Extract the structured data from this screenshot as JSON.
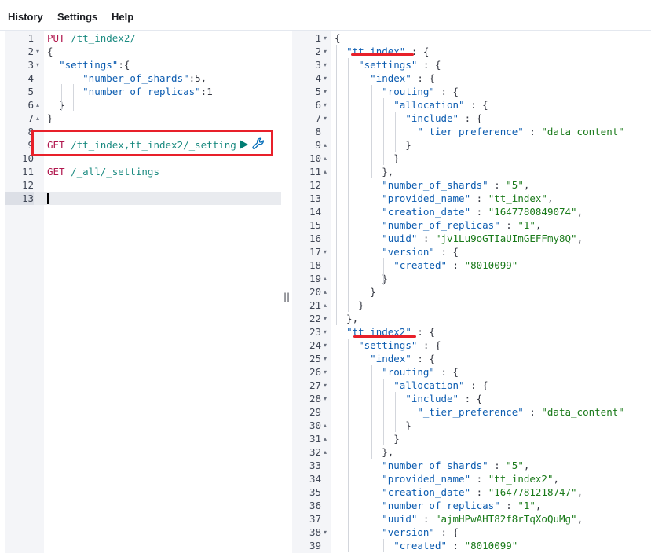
{
  "menu": {
    "history": "History",
    "settings": "Settings",
    "help": "Help"
  },
  "editor_request": {
    "line_numbers": [
      "1",
      "2",
      "3",
      "4",
      "5",
      "6",
      "7",
      "8",
      "9",
      "10",
      "11",
      "12",
      "13"
    ],
    "lines": [
      [
        {
          "t": "PUT",
          "c": "m-put"
        },
        {
          "t": " /tt_index2/",
          "c": "url"
        }
      ],
      [
        {
          "t": "{",
          "c": "pun"
        }
      ],
      [
        {
          "t": "  ",
          "c": "pun"
        },
        {
          "t": "\"settings\"",
          "c": "key"
        },
        {
          "t": ":{",
          "c": "pun"
        }
      ],
      [
        {
          "t": "      ",
          "c": "pun"
        },
        {
          "t": "\"number_of_shards\"",
          "c": "key"
        },
        {
          "t": ":5,",
          "c": "pun"
        }
      ],
      [
        {
          "t": "      ",
          "c": "pun"
        },
        {
          "t": "\"number_of_replicas\"",
          "c": "key"
        },
        {
          "t": ":1",
          "c": "pun"
        }
      ],
      [
        {
          "t": "  }",
          "c": "pun"
        }
      ],
      [
        {
          "t": "}",
          "c": "pun"
        }
      ],
      [],
      [
        {
          "t": "GET",
          "c": "m-get"
        },
        {
          "t": " /tt_index,tt_index2/_setting",
          "c": "url"
        }
      ],
      [],
      [
        {
          "t": "GET",
          "c": "m-get"
        },
        {
          "t": " /_all/_settings",
          "c": "url"
        }
      ],
      [],
      []
    ],
    "fold_markers": [
      "",
      "▾",
      "▾",
      "",
      "",
      "▴",
      "▴",
      "",
      "",
      "",
      "",
      "",
      ""
    ]
  },
  "editor_response": {
    "line_numbers": [
      "1",
      "2",
      "3",
      "4",
      "5",
      "6",
      "7",
      "8",
      "9",
      "10",
      "11",
      "12",
      "13",
      "14",
      "15",
      "16",
      "17",
      "18",
      "19",
      "20",
      "21",
      "22",
      "23",
      "24",
      "25",
      "26",
      "27",
      "28",
      "29",
      "30",
      "31",
      "32",
      "33",
      "34",
      "35",
      "36",
      "37",
      "38",
      "39"
    ],
    "fold_markers": [
      "▾",
      "▾",
      "▾",
      "▾",
      "▾",
      "▾",
      "▾",
      "",
      "▴",
      "▴",
      "▴",
      "",
      "",
      "",
      "",
      "",
      "▾",
      "",
      "▴",
      "▴",
      "▴",
      "▾",
      "▾",
      "▾",
      "▾",
      "▾",
      "▾",
      "▾",
      "",
      "▴",
      "▴",
      "▴",
      "",
      "",
      "",
      "",
      "",
      "▾",
      ""
    ],
    "lines": [
      [
        {
          "t": "{",
          "c": "pun"
        }
      ],
      [
        {
          "t": "  ",
          "c": "pun"
        },
        {
          "t": "\"tt_index\"",
          "c": "key"
        },
        {
          "t": " : {",
          "c": "pun"
        }
      ],
      [
        {
          "t": "    ",
          "c": "pun"
        },
        {
          "t": "\"settings\"",
          "c": "key"
        },
        {
          "t": " : {",
          "c": "pun"
        }
      ],
      [
        {
          "t": "      ",
          "c": "pun"
        },
        {
          "t": "\"index\"",
          "c": "key"
        },
        {
          "t": " : {",
          "c": "pun"
        }
      ],
      [
        {
          "t": "        ",
          "c": "pun"
        },
        {
          "t": "\"routing\"",
          "c": "key"
        },
        {
          "t": " : {",
          "c": "pun"
        }
      ],
      [
        {
          "t": "          ",
          "c": "pun"
        },
        {
          "t": "\"allocation\"",
          "c": "key"
        },
        {
          "t": " : {",
          "c": "pun"
        }
      ],
      [
        {
          "t": "            ",
          "c": "pun"
        },
        {
          "t": "\"include\"",
          "c": "key"
        },
        {
          "t": " : {",
          "c": "pun"
        }
      ],
      [
        {
          "t": "              ",
          "c": "pun"
        },
        {
          "t": "\"_tier_preference\"",
          "c": "key"
        },
        {
          "t": " : ",
          "c": "pun"
        },
        {
          "t": "\"data_content\"",
          "c": "str"
        }
      ],
      [
        {
          "t": "            }",
          "c": "pun"
        }
      ],
      [
        {
          "t": "          }",
          "c": "pun"
        }
      ],
      [
        {
          "t": "        },",
          "c": "pun"
        }
      ],
      [
        {
          "t": "        ",
          "c": "pun"
        },
        {
          "t": "\"number_of_shards\"",
          "c": "key"
        },
        {
          "t": " : ",
          "c": "pun"
        },
        {
          "t": "\"5\"",
          "c": "str"
        },
        {
          "t": ",",
          "c": "pun"
        }
      ],
      [
        {
          "t": "        ",
          "c": "pun"
        },
        {
          "t": "\"provided_name\"",
          "c": "key"
        },
        {
          "t": " : ",
          "c": "pun"
        },
        {
          "t": "\"tt_index\"",
          "c": "str"
        },
        {
          "t": ",",
          "c": "pun"
        }
      ],
      [
        {
          "t": "        ",
          "c": "pun"
        },
        {
          "t": "\"creation_date\"",
          "c": "key"
        },
        {
          "t": " : ",
          "c": "pun"
        },
        {
          "t": "\"1647780849074\"",
          "c": "str"
        },
        {
          "t": ",",
          "c": "pun"
        }
      ],
      [
        {
          "t": "        ",
          "c": "pun"
        },
        {
          "t": "\"number_of_replicas\"",
          "c": "key"
        },
        {
          "t": " : ",
          "c": "pun"
        },
        {
          "t": "\"1\"",
          "c": "str"
        },
        {
          "t": ",",
          "c": "pun"
        }
      ],
      [
        {
          "t": "        ",
          "c": "pun"
        },
        {
          "t": "\"uuid\"",
          "c": "key"
        },
        {
          "t": " : ",
          "c": "pun"
        },
        {
          "t": "\"jv1Lu9oGTIaUImGEFFmy8Q\"",
          "c": "str"
        },
        {
          "t": ",",
          "c": "pun"
        }
      ],
      [
        {
          "t": "        ",
          "c": "pun"
        },
        {
          "t": "\"version\"",
          "c": "key"
        },
        {
          "t": " : {",
          "c": "pun"
        }
      ],
      [
        {
          "t": "          ",
          "c": "pun"
        },
        {
          "t": "\"created\"",
          "c": "key"
        },
        {
          "t": " : ",
          "c": "pun"
        },
        {
          "t": "\"8010099\"",
          "c": "str"
        }
      ],
      [
        {
          "t": "        }",
          "c": "pun"
        }
      ],
      [
        {
          "t": "      }",
          "c": "pun"
        }
      ],
      [
        {
          "t": "    }",
          "c": "pun"
        }
      ],
      [
        {
          "t": "  },",
          "c": "pun"
        }
      ],
      [
        {
          "t": "  ",
          "c": "pun"
        },
        {
          "t": "\"tt_index2\"",
          "c": "key"
        },
        {
          "t": " : {",
          "c": "pun"
        }
      ],
      [
        {
          "t": "    ",
          "c": "pun"
        },
        {
          "t": "\"settings\"",
          "c": "key"
        },
        {
          "t": " : {",
          "c": "pun"
        }
      ],
      [
        {
          "t": "      ",
          "c": "pun"
        },
        {
          "t": "\"index\"",
          "c": "key"
        },
        {
          "t": " : {",
          "c": "pun"
        }
      ],
      [
        {
          "t": "        ",
          "c": "pun"
        },
        {
          "t": "\"routing\"",
          "c": "key"
        },
        {
          "t": " : {",
          "c": "pun"
        }
      ],
      [
        {
          "t": "          ",
          "c": "pun"
        },
        {
          "t": "\"allocation\"",
          "c": "key"
        },
        {
          "t": " : {",
          "c": "pun"
        }
      ],
      [
        {
          "t": "            ",
          "c": "pun"
        },
        {
          "t": "\"include\"",
          "c": "key"
        },
        {
          "t": " : {",
          "c": "pun"
        }
      ],
      [
        {
          "t": "              ",
          "c": "pun"
        },
        {
          "t": "\"_tier_preference\"",
          "c": "key"
        },
        {
          "t": " : ",
          "c": "pun"
        },
        {
          "t": "\"data_content\"",
          "c": "str"
        }
      ],
      [
        {
          "t": "            }",
          "c": "pun"
        }
      ],
      [
        {
          "t": "          }",
          "c": "pun"
        }
      ],
      [
        {
          "t": "        },",
          "c": "pun"
        }
      ],
      [
        {
          "t": "        ",
          "c": "pun"
        },
        {
          "t": "\"number_of_shards\"",
          "c": "key"
        },
        {
          "t": " : ",
          "c": "pun"
        },
        {
          "t": "\"5\"",
          "c": "str"
        },
        {
          "t": ",",
          "c": "pun"
        }
      ],
      [
        {
          "t": "        ",
          "c": "pun"
        },
        {
          "t": "\"provided_name\"",
          "c": "key"
        },
        {
          "t": " : ",
          "c": "pun"
        },
        {
          "t": "\"tt_index2\"",
          "c": "str"
        },
        {
          "t": ",",
          "c": "pun"
        }
      ],
      [
        {
          "t": "        ",
          "c": "pun"
        },
        {
          "t": "\"creation_date\"",
          "c": "key"
        },
        {
          "t": " : ",
          "c": "pun"
        },
        {
          "t": "\"1647781218747\"",
          "c": "str"
        },
        {
          "t": ",",
          "c": "pun"
        }
      ],
      [
        {
          "t": "        ",
          "c": "pun"
        },
        {
          "t": "\"number_of_replicas\"",
          "c": "key"
        },
        {
          "t": " : ",
          "c": "pun"
        },
        {
          "t": "\"1\"",
          "c": "str"
        },
        {
          "t": ",",
          "c": "pun"
        }
      ],
      [
        {
          "t": "        ",
          "c": "pun"
        },
        {
          "t": "\"uuid\"",
          "c": "key"
        },
        {
          "t": " : ",
          "c": "pun"
        },
        {
          "t": "\"ajmHPwAHT82f8rTqXoQuMg\"",
          "c": "str"
        },
        {
          "t": ",",
          "c": "pun"
        }
      ],
      [
        {
          "t": "        ",
          "c": "pun"
        },
        {
          "t": "\"version\"",
          "c": "key"
        },
        {
          "t": " : {",
          "c": "pun"
        }
      ],
      [
        {
          "t": "          ",
          "c": "pun"
        },
        {
          "t": "\"created\"",
          "c": "key"
        },
        {
          "t": " : ",
          "c": "pun"
        },
        {
          "t": "\"8010099\"",
          "c": "str"
        }
      ]
    ]
  },
  "colors": {
    "annotation_red": "#e8202a",
    "method": "#b1174e",
    "url": "#1a8a80",
    "key": "#0c5cb0",
    "string": "#1a7a1a"
  },
  "icons": {
    "run": "play-icon",
    "settings": "wrench-icon",
    "resizer": "drag-handle-icon"
  }
}
